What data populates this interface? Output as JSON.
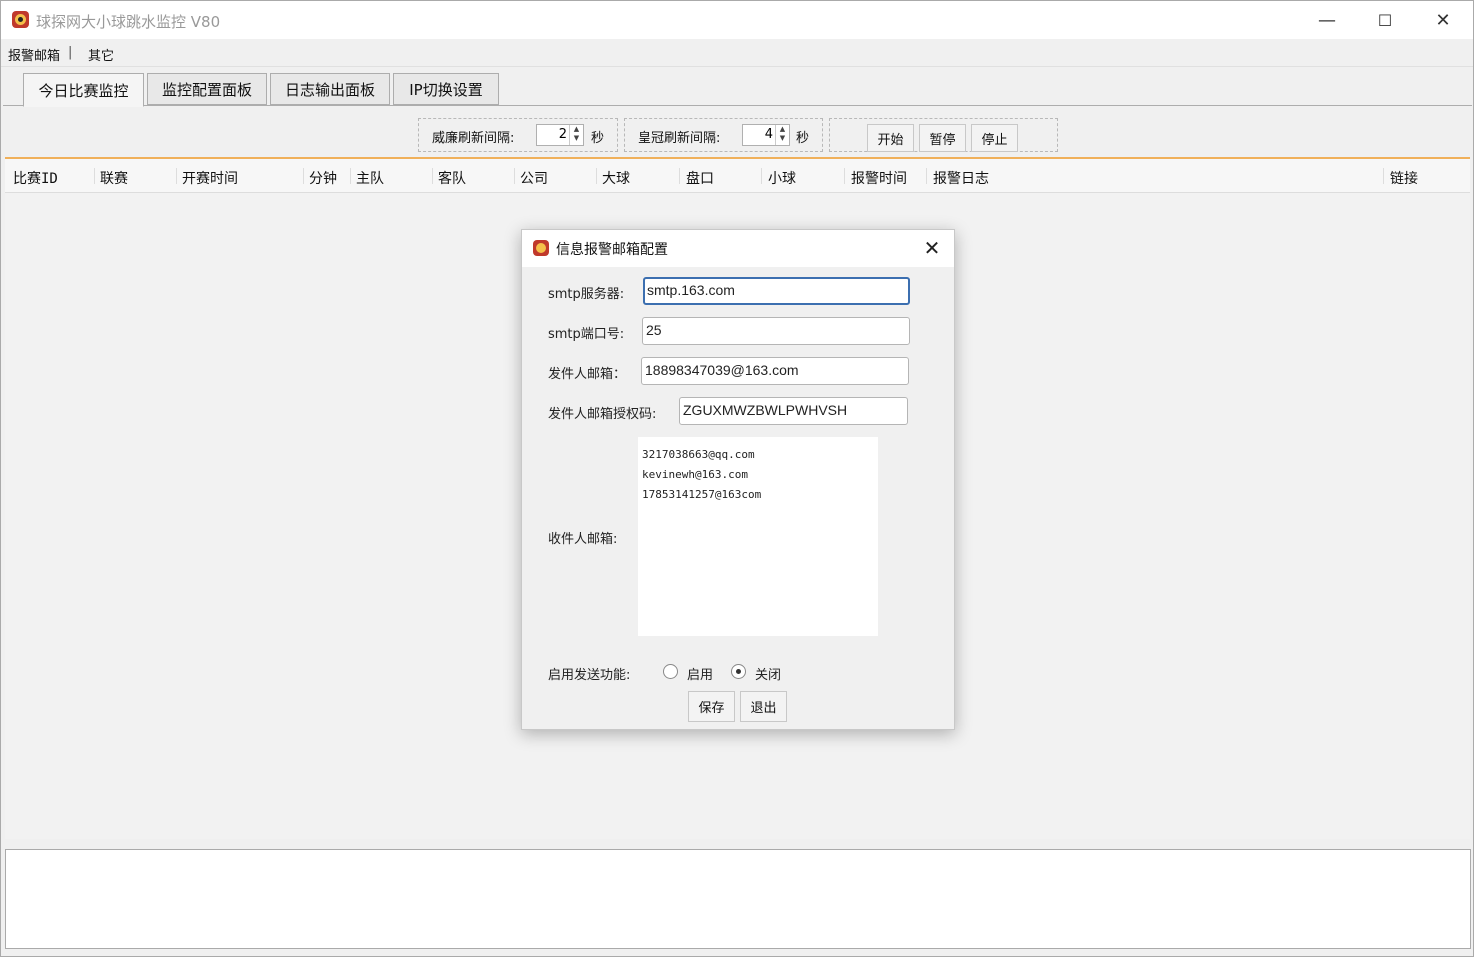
{
  "window": {
    "title": "球探网大小球跳水监控 V80",
    "minimize": "—",
    "maximize": "☐",
    "close": "✕"
  },
  "menu": {
    "items": [
      "报警邮箱",
      "|",
      "其它"
    ]
  },
  "tabs": [
    "今日比赛监控",
    "监控配置面板",
    "日志输出面板",
    "IP切换设置"
  ],
  "controls": {
    "weilian_label": "威廉刷新间隔:",
    "weilian_value": "2",
    "weilian_unit": "秒",
    "huangguan_label": "皇冠刷新间隔:",
    "huangguan_value": "4",
    "huangguan_unit": "秒",
    "start": "开始",
    "pause": "暂停",
    "stop": "停止"
  },
  "table": {
    "columns": [
      "比赛ID",
      "联赛",
      "开赛时间",
      "分钟",
      "主队",
      "客队",
      "公司",
      "大球",
      "盘口",
      "小球",
      "报警时间",
      "报警日志",
      "链接"
    ]
  },
  "dialog": {
    "title": "信息报警邮箱配置",
    "close": "✕",
    "smtp_server_label": "smtp服务器:",
    "smtp_server_value": "smtp.163.com",
    "smtp_port_label": "smtp端口号:",
    "smtp_port_value": "25",
    "sender_label": "发件人邮箱：",
    "sender_value": "18898347039@163.com",
    "auth_label": "发件人邮箱授权码:",
    "auth_value": "ZGUXMWZBWLPWHVSH",
    "recipients_label": "收件人邮箱:",
    "recipients": [
      "3217038663@qq.com",
      "kevinewh@163.com",
      "17853141257@163com"
    ],
    "enable_label": "启用发送功能:",
    "enable_on": "启用",
    "enable_off": "关闭",
    "enabled": false,
    "save": "保存",
    "exit": "退出"
  }
}
